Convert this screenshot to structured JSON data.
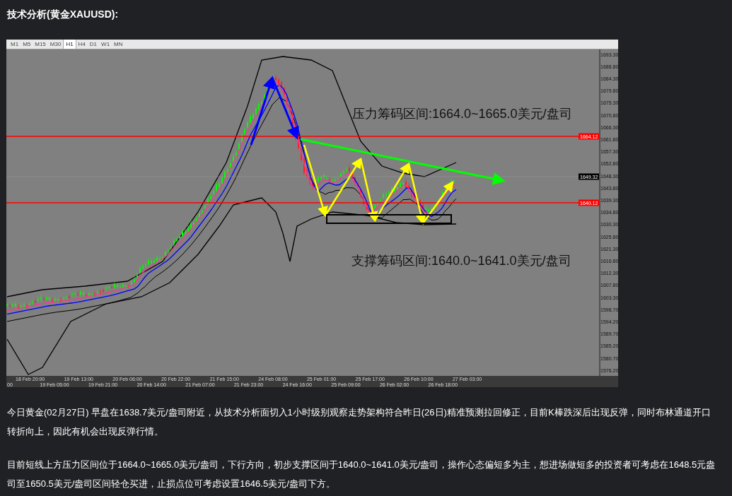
{
  "title": "技术分析(黄金XAUUSD):",
  "chart": {
    "timeframes": [
      {
        "label": "M1",
        "selected": false
      },
      {
        "label": "M5",
        "selected": false
      },
      {
        "label": "M15",
        "selected": false
      },
      {
        "label": "M30",
        "selected": false
      },
      {
        "label": "H1",
        "selected": true
      },
      {
        "label": "H4",
        "selected": false
      },
      {
        "label": "D1",
        "selected": false
      },
      {
        "label": "W1",
        "selected": false
      },
      {
        "label": "MN",
        "selected": false
      }
    ],
    "price_labels": [
      "1693.30",
      "1688.80",
      "1684.30",
      "1679.80",
      "1675.30",
      "1670.80",
      "1666.30",
      "1661.80",
      "1657.30",
      "1652.80",
      "1648.30",
      "1643.80",
      "1639.30",
      "1634.80",
      "1630.30",
      "1625.80",
      "1621.30",
      "1616.80",
      "1612.30",
      "1607.80",
      "1603.30",
      "1598.70",
      "1594.20",
      "1589.70",
      "1585.20",
      "1580.70",
      "1576.20"
    ],
    "time_labels": [
      "00",
      "18 Feb 20:00",
      "19 Feb 05:00",
      "19 Feb 13:00",
      "19 Feb 21:00",
      "20 Feb 06:00",
      "20 Feb 14:00",
      "20 Feb 22:00",
      "21 Feb 07:00",
      "21 Feb 15:00",
      "21 Feb 23:00",
      "24 Feb 08:00",
      "24 Feb 16:00",
      "25 Feb 01:00",
      "25 Feb 09:00",
      "25 Feb 17:00",
      "26 Feb 02:00",
      "26 Feb 10:00",
      "26 Feb 18:00",
      "27 Feb 03:00"
    ],
    "markers": [
      {
        "kind": "resistance",
        "label": "1664.12"
      },
      {
        "kind": "current",
        "label": "1649.32"
      },
      {
        "kind": "support",
        "label": "1640.12"
      }
    ],
    "annotations": [
      {
        "kind": "resistance",
        "text": "压力筹码区间:1664.0~1665.0美元/盘司"
      },
      {
        "kind": "support",
        "text": "支撑筹码区间:1640.0~1641.0美元/盘司"
      }
    ]
  },
  "paragraphs": [
    "今日黄金(02月27日) 早盘在1638.7美元/盎司附近，从技术分析面切入1小时级别观察走势架构符合昨日(26日)精准预测拉回修正，目前K棒跌深后出现反弹，同时布林通道开口转折向上，因此有机会出现反弹行情。",
    "目前短线上方压力区间位于1664.0~1665.0美元/盎司，下行方向，初步支撑区间于1640.0~1641.0美元/盎司，操作心态偏短多为主，想进场做短多的投资者可考虑在1648.5元盎司至1650.5美元/盎司区间轻仓买进，止损点位可考虑设置1646.5美元/盎司下方。"
  ]
}
